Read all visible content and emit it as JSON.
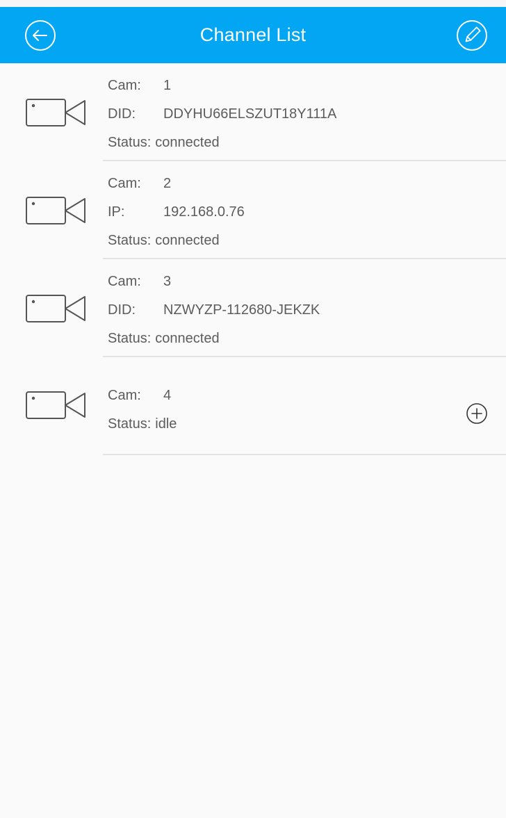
{
  "header": {
    "title": "Channel List",
    "accent_color": "#02a6f2",
    "back_icon": "arrow-left-circle-icon",
    "edit_icon": "pencil-circle-icon"
  },
  "channels": [
    {
      "cam_label": "Cam:",
      "cam_value": "1",
      "id_label": "DID:",
      "id_value": "DDYHU66ELSZUT18Y111A",
      "status_label": "Status:",
      "status_value": "connected",
      "icon": "video-camera-icon"
    },
    {
      "cam_label": "Cam:",
      "cam_value": "2",
      "id_label": "IP:",
      "id_value": "192.168.0.76",
      "status_label": "Status:",
      "status_value": "connected",
      "icon": "video-camera-icon"
    },
    {
      "cam_label": "Cam:",
      "cam_value": "3",
      "id_label": "DID:",
      "id_value": "NZWYZP-112680-JEKZK",
      "status_label": "Status:",
      "status_value": "connected",
      "icon": "video-camera-icon"
    },
    {
      "cam_label": "Cam:",
      "cam_value": "4",
      "status_label": "Status:",
      "status_value": "idle",
      "icon": "video-camera-icon",
      "action_icon": "plus-circle-icon"
    }
  ]
}
